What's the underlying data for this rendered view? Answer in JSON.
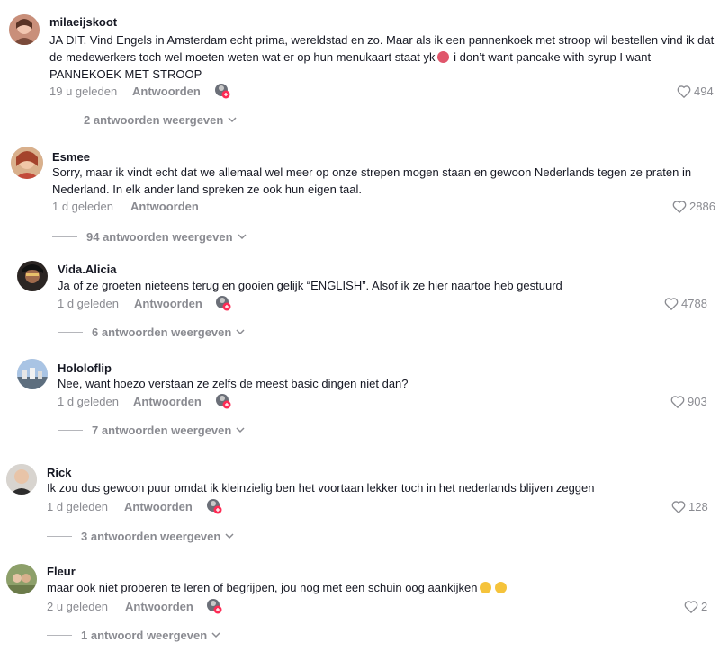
{
  "comments": [
    {
      "username": "milaeijskoot",
      "text_before_emoji": "JA DIT. Vind Engels in Amsterdam echt prima, wereldstad en zo. Maar als ik een pannenkoek met stroop wil bestellen vind ik dat de medewerkers toch wel moeten weten wat er op hun menukaart staat yk",
      "text_after_emoji": " i don’t want pancake with syrup I want PANNEKOEK MET STROOP",
      "time": "19 u geleden",
      "reply_label": "Antwoorden",
      "likes": "494",
      "view_replies": "2 antwoorden weergeven",
      "has_creator_badge": true
    },
    {
      "username": "Esmee",
      "text": "Sorry, maar ik vindt echt dat we allemaal wel meer op onze strepen mogen staan en gewoon Nederlands tegen ze praten in Nederland. In elk ander land spreken ze ook hun eigen taal.",
      "time": "1 d geleden",
      "reply_label": "Antwoorden",
      "likes": "2886",
      "view_replies": "94 antwoorden weergeven",
      "has_creator_badge": false
    },
    {
      "username": "Vida.Alicia",
      "text": "Ja of ze groeten nieteens terug en gooien gelijk “ENGLISH”. Alsof ik ze hier naartoe heb gestuurd",
      "time": "1 d geleden",
      "reply_label": "Antwoorden",
      "likes": "4788",
      "view_replies": "6 antwoorden weergeven",
      "has_creator_badge": true
    },
    {
      "username": "Hololoflip",
      "text": "Nee, want hoezo verstaan ze zelfs de meest basic dingen niet dan?",
      "time": "1 d geleden",
      "reply_label": "Antwoorden",
      "likes": "903",
      "view_replies": "7 antwoorden weergeven",
      "has_creator_badge": true
    },
    {
      "username": "Rick",
      "text": "Ik zou dus gewoon puur omdat ik kleinzielig ben het voortaan lekker toch in het nederlands blijven zeggen",
      "time": "1 d geleden",
      "reply_label": "Antwoorden",
      "likes": "128",
      "view_replies": "3 antwoorden weergeven",
      "has_creator_badge": true
    },
    {
      "username": "Fleur",
      "text": "maar ook niet proberen te leren of begrijpen, jou nog met een schuin oog aankijken",
      "time": "2 u geleden",
      "reply_label": "Antwoorden",
      "likes": "2",
      "view_replies": "1 antwoord weergeven",
      "has_creator_badge": true
    }
  ],
  "colors": {
    "text": "#161823",
    "muted": "#8a8b91",
    "badge": "#fe2c55"
  },
  "icons": {
    "like": "heart-outline-icon",
    "expand": "chevron-down-icon",
    "creator": "creator-badge-icon"
  }
}
